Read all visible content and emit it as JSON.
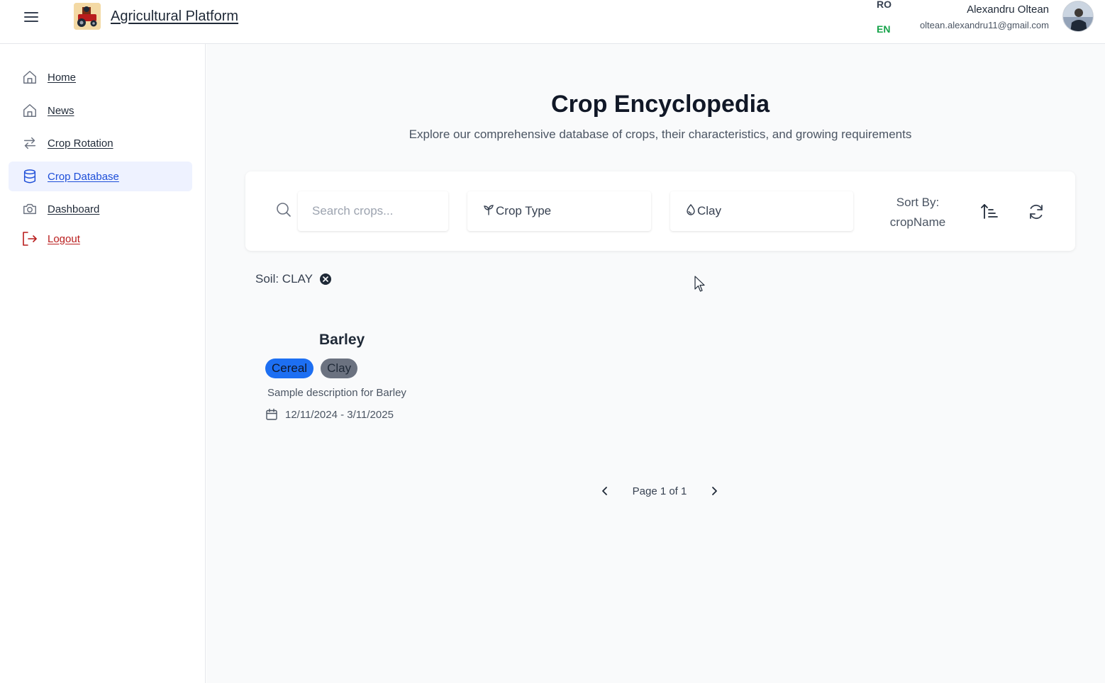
{
  "header": {
    "app_title": "Agricultural Platform",
    "logo_icon": "tractor-logo-icon",
    "languages": [
      "RO",
      "EN"
    ],
    "active_language": "EN",
    "user_name": "Alexandru Oltean",
    "user_email": "oltean.alexandru11@gmail.com"
  },
  "sidebar": {
    "items": [
      {
        "label": "Home",
        "icon": "home-icon"
      },
      {
        "label": "News",
        "icon": "home-icon"
      },
      {
        "label": "Crop Rotation",
        "icon": "repeat-icon"
      },
      {
        "label": "Crop Database",
        "icon": "database-icon",
        "active": true
      },
      {
        "label": "Dashboard",
        "icon": "camera-icon"
      },
      {
        "label": "Logout",
        "icon": "logout-icon"
      }
    ]
  },
  "main": {
    "title": "Crop Encyclopedia",
    "subtitle": "Explore our comprehensive database of crops, their characteristics, and growing requirements",
    "filters": {
      "search_placeholder": "Search crops...",
      "crop_type_label": "Crop Type",
      "soil_label": "Clay",
      "sort_by_label": "Sort By:",
      "sort_field": "cropName"
    },
    "active_filter_chip": "Soil: CLAY",
    "crops": [
      {
        "name": "Barley",
        "badges": [
          "Cereal",
          "Clay"
        ],
        "description": "Sample description for Barley",
        "dates": "12/11/2024 - 3/11/2025"
      }
    ],
    "pagination": {
      "text": "Page 1 of 1"
    }
  },
  "colors": {
    "active_nav_bg": "#eef2ff",
    "active_nav_text": "#1d4ed8",
    "logout_text": "#b91c1c",
    "lang_active": "#16a34a",
    "badge_cereal": "#1d6ff2",
    "badge_clay": "#6b7280"
  }
}
